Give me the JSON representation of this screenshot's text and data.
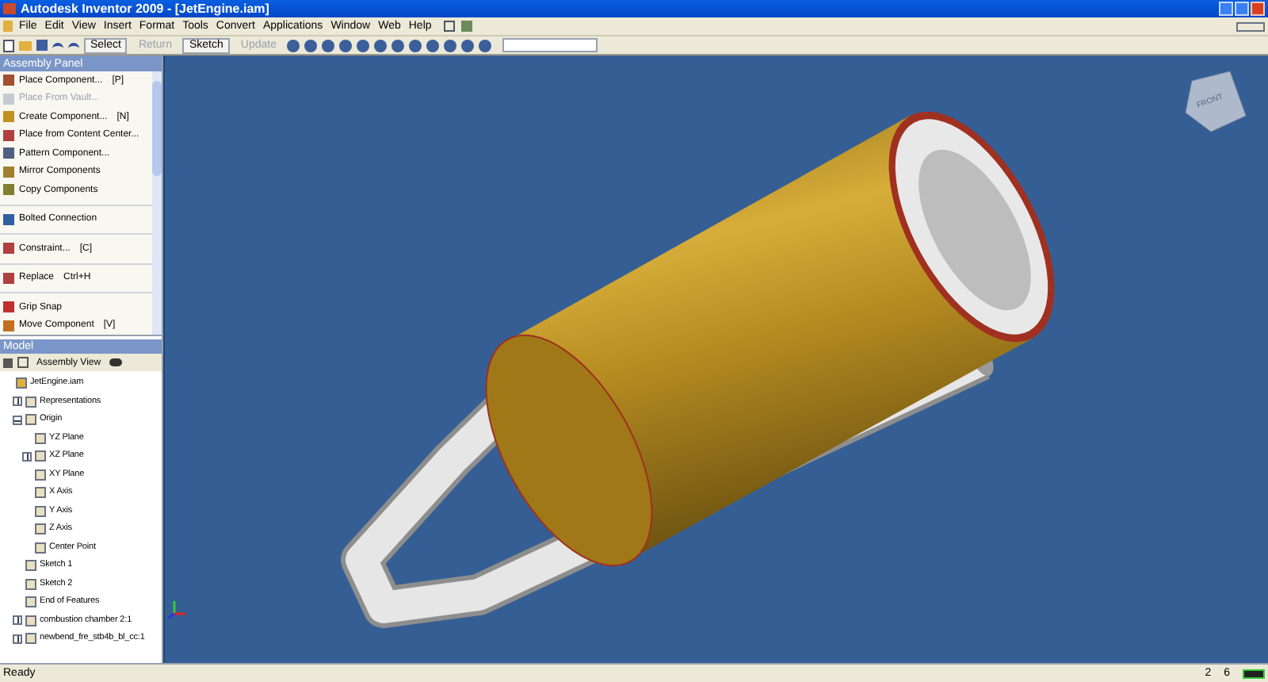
{
  "window": {
    "title": "Autodesk Inventor 2009 - [JetEngine.iam]"
  },
  "menu": [
    "File",
    "Edit",
    "View",
    "Insert",
    "Format",
    "Tools",
    "Convert",
    "Applications",
    "Window",
    "Web",
    "Help"
  ],
  "toolbar": {
    "buttons": [
      {
        "label": "Select",
        "disabled": false
      },
      {
        "label": "Return",
        "disabled": true
      },
      {
        "label": "Sketch",
        "disabled": false
      },
      {
        "label": "Update",
        "disabled": true
      }
    ]
  },
  "assembly_panel": {
    "title": "Assembly Panel",
    "groups": [
      [
        {
          "label": "Place Component...",
          "shortcut": "[P]",
          "disabled": false
        },
        {
          "label": "Place From Vault...",
          "disabled": true
        },
        {
          "label": "Create Component...",
          "shortcut": "[N]",
          "disabled": false
        },
        {
          "label": "Place from Content Center...",
          "disabled": false
        },
        {
          "label": "Pattern Component...",
          "disabled": false
        },
        {
          "label": "Mirror Components",
          "disabled": false
        },
        {
          "label": "Copy Components",
          "disabled": false
        }
      ],
      [
        {
          "label": "Bolted Connection",
          "disabled": false
        }
      ],
      [
        {
          "label": "Constraint...",
          "shortcut": "[C]",
          "disabled": false
        }
      ],
      [
        {
          "label": "Replace",
          "shortcut": "Ctrl+H",
          "disabled": false
        }
      ],
      [
        {
          "label": "Grip Snap",
          "disabled": false
        },
        {
          "label": "Move Component",
          "shortcut": "[V]",
          "disabled": false
        }
      ]
    ]
  },
  "model_browser": {
    "title": "Model",
    "view": "Assembly View",
    "tree": [
      {
        "label": "JetEngine.iam",
        "children": [
          {
            "label": "Representations",
            "expanded": false
          },
          {
            "label": "Origin",
            "expanded": true,
            "children": [
              {
                "label": "YZ Plane"
              },
              {
                "label": "XZ Plane",
                "expanded": false
              },
              {
                "label": "XY Plane"
              },
              {
                "label": "X Axis"
              },
              {
                "label": "Y Axis"
              },
              {
                "label": "Z Axis"
              },
              {
                "label": "Center Point"
              }
            ]
          },
          {
            "label": "Sketch 1"
          },
          {
            "label": "Sketch 2"
          },
          {
            "label": "End of Features"
          },
          {
            "label": "combustion chamber 2:1",
            "expanded": false
          },
          {
            "label": "newbend_fre_stb4b_bl_cc:1",
            "expanded": false
          }
        ]
      }
    ]
  },
  "viewcube": {
    "label": "FRONT"
  },
  "status_bar": {
    "message": "Ready",
    "field_1": "2",
    "field_2": "6"
  }
}
